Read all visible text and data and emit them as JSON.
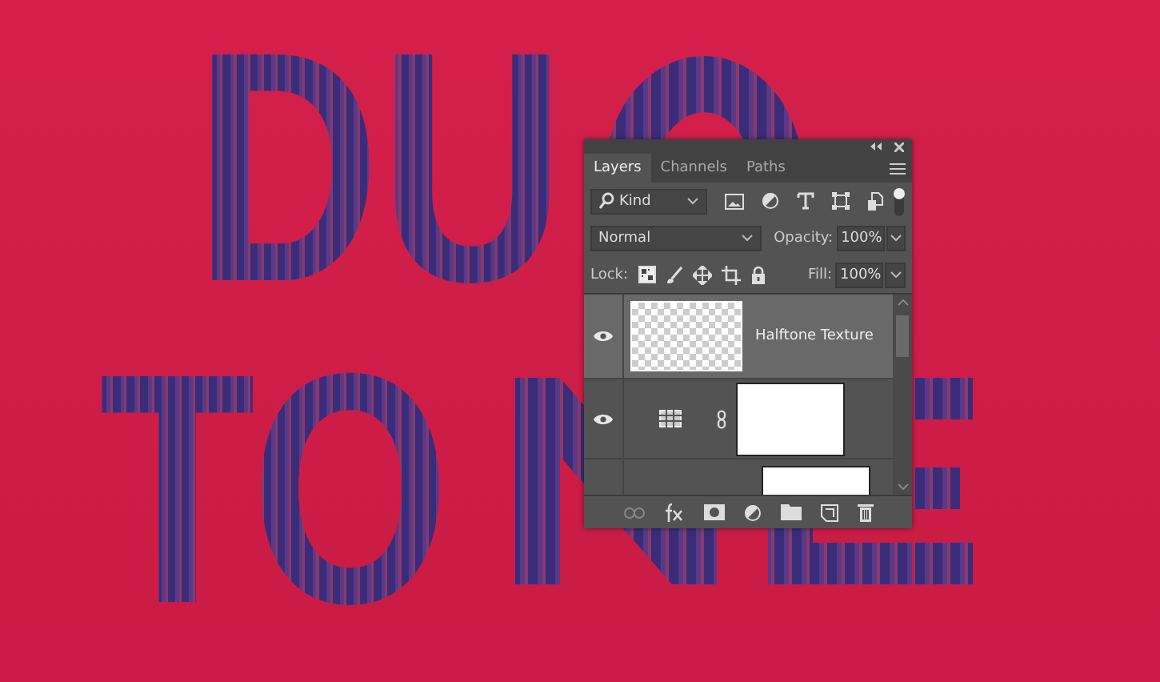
{
  "canvas": {
    "lines": [
      "DU",
      "TO"
    ]
  },
  "panel": {
    "tabs": [
      {
        "label": "Layers",
        "selected": true
      },
      {
        "label": "Channels",
        "selected": false
      },
      {
        "label": "Paths",
        "selected": false
      }
    ],
    "filter": {
      "value": "Kind"
    },
    "blend_mode": {
      "value": "Normal"
    },
    "opacity": {
      "label": "Opacity:",
      "value": "100%"
    },
    "lock": {
      "label": "Lock:"
    },
    "fill": {
      "label": "Fill:",
      "value": "100%"
    },
    "layers": [
      {
        "kind": "pixel",
        "name": "Halftone Texture",
        "selected": true,
        "visible": true
      },
      {
        "kind": "adjustment",
        "selected": false,
        "visible": true
      },
      {
        "kind": "partial",
        "selected": false,
        "visible": false
      }
    ]
  }
}
